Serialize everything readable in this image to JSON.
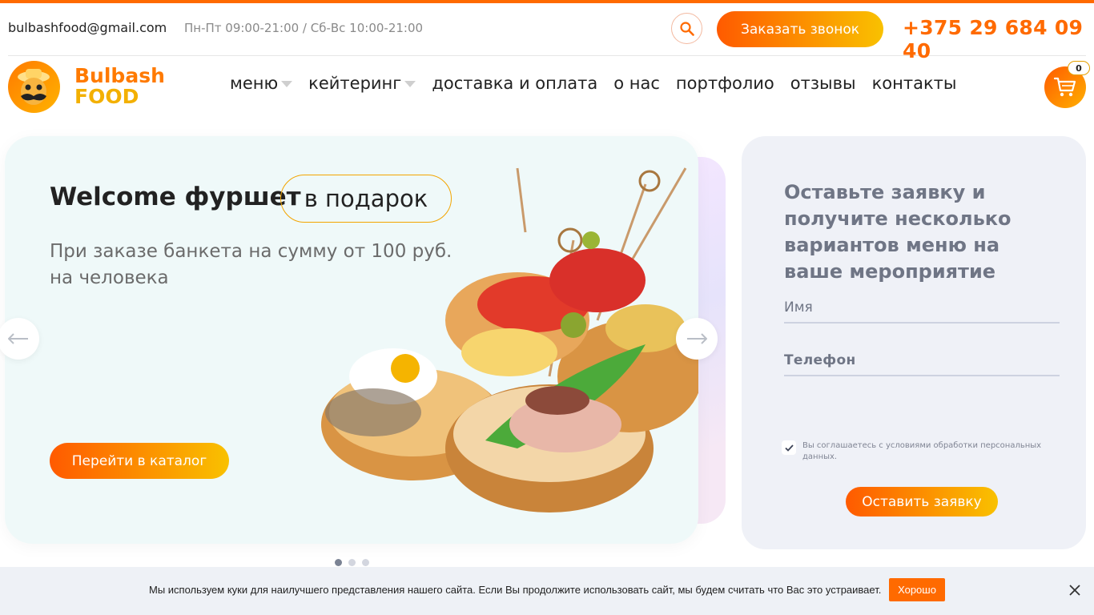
{
  "topbar": {
    "email": "bulbashfood@gmail.com",
    "hours": "Пн-Пт 09:00-21:00 / Сб-Вс 10:00-21:00",
    "order_call": "Заказать звонок",
    "phone": "+375 29 684 09 40"
  },
  "logo": {
    "line1": "Bulbash",
    "line2": "FOOD"
  },
  "nav": {
    "items": [
      {
        "label": "меню"
      },
      {
        "label": "кейтеринг"
      },
      {
        "label": "доставка и оплата"
      },
      {
        "label": "о нас"
      },
      {
        "label": "портфолио"
      },
      {
        "label": "отзывы"
      },
      {
        "label": "контакты"
      }
    ]
  },
  "cart": {
    "count": "0"
  },
  "slide": {
    "title": "Welcome фуршет",
    "tag": "в подарок",
    "subtitle": "При заказе банкета на сумму от 100 руб. на человека",
    "catalog_button": "Перейти в каталог"
  },
  "slider": {
    "active_index": 0,
    "count": 3
  },
  "form": {
    "heading": "Оставьте заявку и получите несколько вариантов меню на ваше мероприятие",
    "name_placeholder": "Имя",
    "phone_placeholder": "Телефон",
    "consent": "Вы соглашаетесь с условиями обработки персональных данных.",
    "submit": "Оставить заявку"
  },
  "cookie": {
    "text": "Мы используем куки для наилучшего представления нашего сайта. Если Вы продолжите использовать сайт, мы будем считать что Вас это устраивает.",
    "ok": "Хорошо"
  },
  "colors": {
    "accent": "#ff6a00",
    "accent_gold": "#f9c100",
    "form_bg": "#eff1f7",
    "slide_bg": "#eff9f9"
  },
  "icons": [
    "search-icon",
    "cart-icon",
    "arrow-left-icon",
    "arrow-right-icon",
    "check-icon",
    "close-icon",
    "caret-down-icon"
  ]
}
